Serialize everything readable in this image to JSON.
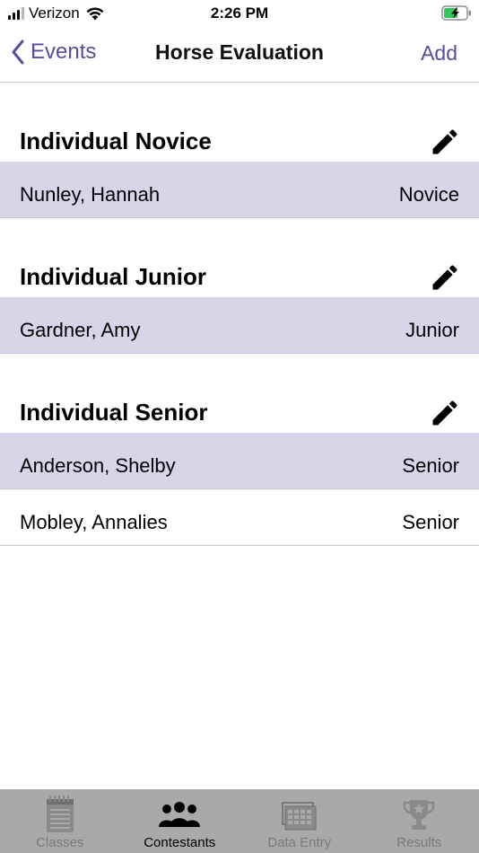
{
  "status_bar": {
    "carrier": "Verizon",
    "time": "2:26 PM",
    "battery_color": "#34c759"
  },
  "nav": {
    "back_label": "Events",
    "title": "Horse Evaluation",
    "add_label": "Add",
    "accent_color": "#5c4a9e"
  },
  "sections": [
    {
      "title": "Individual Novice",
      "rows": [
        {
          "name": "Nunley, Hannah",
          "level": "Novice",
          "highlighted": true
        }
      ]
    },
    {
      "title": "Individual Junior",
      "rows": [
        {
          "name": "Gardner, Amy",
          "level": "Junior",
          "highlighted": true
        }
      ]
    },
    {
      "title": "Individual Senior",
      "rows": [
        {
          "name": "Anderson, Shelby",
          "level": "Senior",
          "highlighted": true
        },
        {
          "name": "Mobley, Annalies",
          "level": "Senior",
          "highlighted": false
        }
      ]
    }
  ],
  "tabs": [
    {
      "label": "Classes",
      "icon": "notepad-icon",
      "active": false
    },
    {
      "label": "Contestants",
      "icon": "people-icon",
      "active": true
    },
    {
      "label": "Data Entry",
      "icon": "data-entry-icon",
      "active": false
    },
    {
      "label": "Results",
      "icon": "trophy-icon",
      "active": false
    }
  ]
}
